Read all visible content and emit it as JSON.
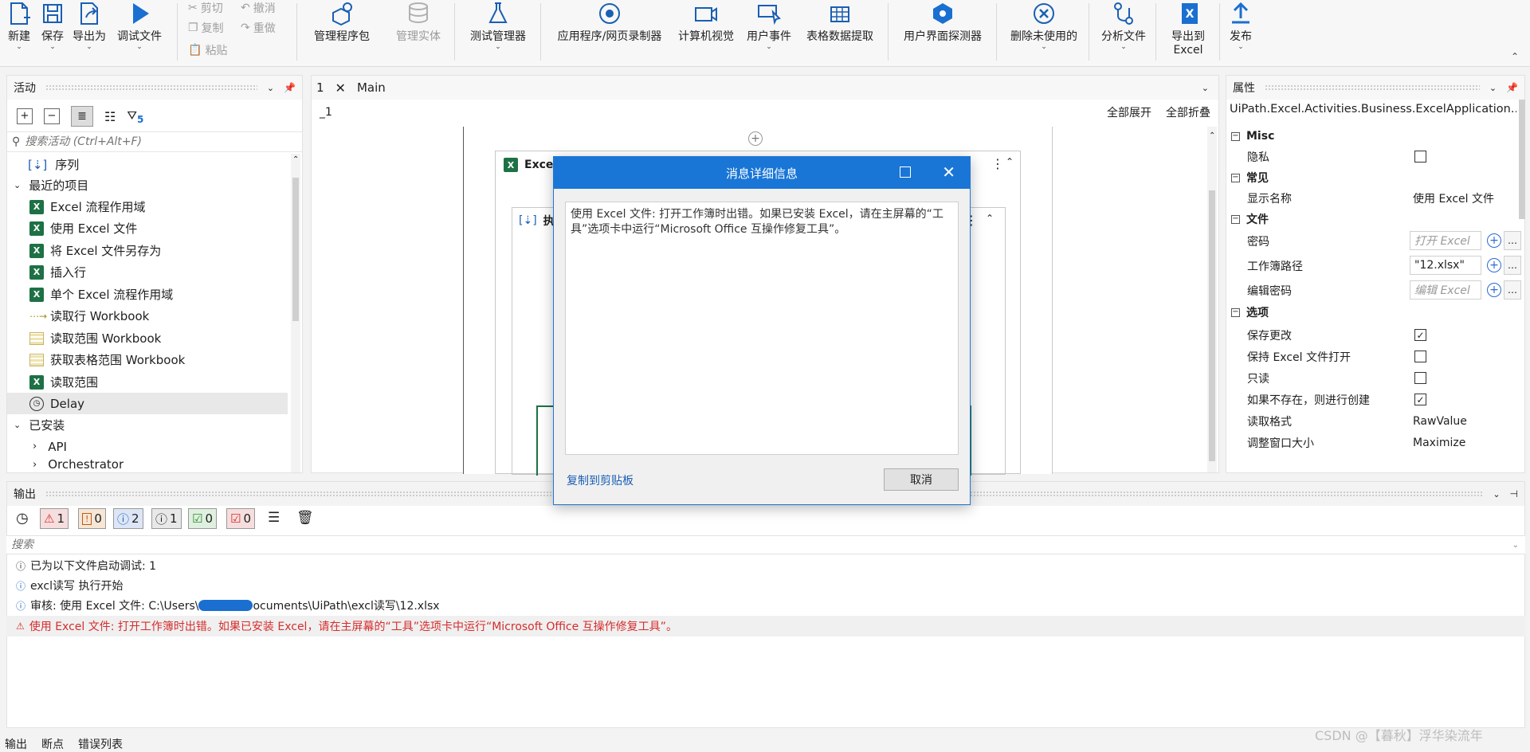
{
  "ribbon": {
    "new": "新建",
    "save": "保存",
    "export_as": "导出为",
    "debug_file": "调试文件",
    "cut": "剪切",
    "undo": "撤消",
    "copy": "复制",
    "redo": "重做",
    "paste": "粘贴",
    "manage_packages": "管理程序包",
    "manage_entities": "管理实体",
    "test_manager": "测试管理器",
    "recorder": "应用程序/网页录制器",
    "computer_vision": "计算机视觉",
    "user_events": "用户事件",
    "table_extraction": "表格数据提取",
    "ui_explorer": "用户界面探测器",
    "remove_unused": "删除未使用的",
    "analyze_file": "分析文件",
    "export_excel_1": "导出到",
    "export_excel_2": "Excel",
    "publish": "发布"
  },
  "activities": {
    "title": "活动",
    "filter_count": "5",
    "search_placeholder": "搜索活动 (Ctrl+Alt+F)",
    "sequence": "序列",
    "recent": "最近的项目",
    "items": [
      "Excel 流程作用域",
      "使用 Excel 文件",
      "将 Excel 文件另存为",
      "插入行",
      "单个 Excel 流程作用域",
      "读取行 Workbook",
      "读取范围 Workbook",
      "获取表格范围 Workbook",
      "读取范围",
      "Delay"
    ],
    "installed": "已安装",
    "api": "API",
    "orchestrator": "Orchestrator"
  },
  "designer": {
    "tab_number": "1",
    "tab_name": "Main",
    "breadcrumb": "_1",
    "expand_all": "全部展开",
    "collapse_all": "全部折叠",
    "card_title": "Exce",
    "inner_title": "执"
  },
  "properties": {
    "title": "属性",
    "type_name": "UiPath.Excel.Activities.Business.ExcelApplication...",
    "misc": "Misc",
    "private": "隐私",
    "common": "常见",
    "display_name_key": "显示名称",
    "display_name_val": "使用 Excel 文件",
    "file": "文件",
    "password": "密码",
    "password_ph": "打开 Excel",
    "workbook_path": "工作簿路径",
    "workbook_path_val": "\"12.xlsx\"",
    "edit_password": "编辑密码",
    "edit_password_ph": "编辑 Excel",
    "options": "选项",
    "save_changes": "保存更改",
    "keep_open": "保持 Excel 文件打开",
    "read_only": "只读",
    "create_if_missing": "如果不存在，则进行创建",
    "read_format": "读取格式",
    "read_format_val": "RawValue",
    "resize_window": "调整窗口大小",
    "resize_window_val": "Maximize"
  },
  "output": {
    "title": "输出",
    "counts": {
      "error": "1",
      "warn": "0",
      "info": "2",
      "trace": "1",
      "ok": "0",
      "fatal": "0"
    },
    "search_placeholder": "搜索",
    "logs": [
      "已为以下文件启动调试: 1",
      "excl读写 执行开始",
      "审核: 使用 Excel 文件: C:\\Users\\",
      "ocuments\\UiPath\\excl读写\\12.xlsx",
      "使用 Excel 文件: 打开工作簿时出错。如果已安装 Excel，请在主屏幕的“工具”选项卡中运行“Microsoft Office 互操作修复工具”。"
    ],
    "bottom_tabs": [
      "输出",
      "断点",
      "错误列表"
    ]
  },
  "modal": {
    "title": "消息详细信息",
    "message": "使用 Excel 文件: 打开工作簿时出错。如果已安装 Excel，请在主屏幕的“工具”选项卡中运行“Microsoft Office 互操作修复工具”。",
    "copy_link": "复制到剪贴板",
    "cancel": "取消"
  },
  "watermark": "CSDN @【暮秋】浮华染流年",
  "colors": {
    "accent": "#1976d6",
    "excel_green": "#1e7145",
    "error_red": "#d62d2d"
  }
}
